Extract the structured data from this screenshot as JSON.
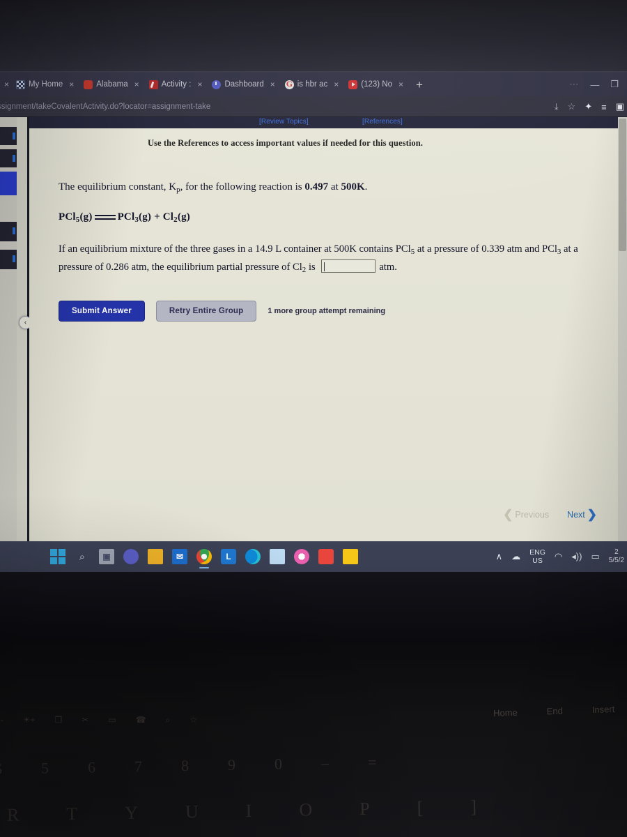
{
  "browser": {
    "tabs": [
      {
        "label": "My Home",
        "favicon": "mosaic-icon",
        "close": "×"
      },
      {
        "label": "Alabama",
        "favicon": "red-square-icon",
        "close": "×"
      },
      {
        "label": "Activity :",
        "favicon": "pencil-icon",
        "close": "×"
      },
      {
        "label": "Dashboard",
        "favicon": "power-icon",
        "close": "×"
      },
      {
        "label": "is hbr ac",
        "favicon": "google-icon",
        "close": "×"
      },
      {
        "label": "(123) No",
        "favicon": "youtube-icon",
        "close": "×"
      }
    ],
    "leading_close": "×",
    "new_tab": "+",
    "window_controls": {
      "more": "⋯",
      "minimize": "—",
      "restore": "❐"
    },
    "url": "ssignment/takeCovalentActivity.do?locator=assignment-take",
    "omnibox_icons": {
      "install": "⤓",
      "star": "☆",
      "extensions": "✦",
      "reading_list": "≡",
      "profile": "▣"
    }
  },
  "page": {
    "top_links": {
      "review_topics": "[Review Topics]",
      "references": "[References]"
    },
    "reference_note": "Use the References to access important values if needed for this question.",
    "question": {
      "line1_pre": "The equilibrium constant, K",
      "line1_sub": "p",
      "line1_mid": ", for the following reaction is ",
      "kp_value": "0.497",
      "line1_at": " at ",
      "temperature": "500K",
      "line1_end": ".",
      "equation": {
        "reactant": "PCl5(g)",
        "arrow": "equilibrium-double-arrow",
        "products": "PCl3(g) + Cl2(g)"
      },
      "body_1": "If an equilibrium mixture of the three gases in a ",
      "volume": "14.9",
      "body_2": " L container at ",
      "temp2": "500K",
      "body_3": " contains ",
      "species_1": "PCl5",
      "body_4": " at a pressure of ",
      "pressure_1": "0.339",
      "body_5": " atm and ",
      "species_2": "PCl3",
      "body_6": " at a pressure of ",
      "pressure_2": "0.286",
      "body_7": " atm, the equilibrium partial pressure of ",
      "species_3": "Cl2",
      "body_8": " is ",
      "unit": "atm."
    },
    "answer_input": {
      "value": "",
      "placeholder": ""
    },
    "buttons": {
      "submit": "Submit Answer",
      "retry": "Retry Entire Group",
      "attempts": "1 more group attempt remaining"
    },
    "pager": {
      "previous": "Previous",
      "next": "Next",
      "prev_chevron": "❮",
      "next_chevron": "❯"
    },
    "sidebar_collapse": "‹"
  },
  "taskbar": {
    "icons": [
      {
        "name": "start-icon",
        "label": ""
      },
      {
        "name": "search-icon",
        "label": "⌕"
      },
      {
        "name": "task-view-icon",
        "label": "▣"
      },
      {
        "name": "teams-icon",
        "label": ""
      },
      {
        "name": "file-explorer-icon",
        "label": ""
      },
      {
        "name": "mail-icon",
        "label": "✉"
      },
      {
        "name": "chrome-icon",
        "label": ""
      },
      {
        "name": "lockdown-browser-icon",
        "label": "L"
      },
      {
        "name": "edge-icon",
        "label": ""
      },
      {
        "name": "photos-icon",
        "label": ""
      },
      {
        "name": "itunes-icon",
        "label": "♪"
      },
      {
        "name": "office-icon",
        "label": ""
      },
      {
        "name": "sticky-notes-icon",
        "label": ""
      }
    ],
    "tray": {
      "overflow": "∧",
      "cloud": "☁",
      "language_top": "ENG",
      "language_bottom": "US",
      "wifi": "◠",
      "volume": "◂))",
      "battery": "▭",
      "clock_top": "2",
      "clock_bottom": "5/5/2"
    }
  },
  "keyboard": {
    "fn_row": [
      "☀-",
      "☀+",
      "❐",
      "✂",
      "▭",
      "☎",
      "⌕",
      "☆"
    ],
    "number_row": [
      {
        "shift": "$",
        "key": ""
      },
      {
        "shift": "%",
        "key": "5"
      },
      {
        "shift": "^",
        "key": "6"
      },
      {
        "shift": "&",
        "key": "7"
      },
      {
        "shift": "*",
        "key": "8"
      },
      {
        "shift": "(",
        "key": "9"
      },
      {
        "shift": ")",
        "key": "0"
      },
      {
        "shift": "—",
        "key": "–"
      },
      {
        "shift": "+",
        "key": "="
      }
    ],
    "letter_row": [
      "R",
      "T",
      "Y",
      "U",
      "I",
      "O",
      "P",
      "[",
      "]"
    ],
    "nav_keys": [
      "Home",
      "End",
      "Insert"
    ]
  },
  "colors": {
    "browser_chrome": "#35354a",
    "page_background": "#e3e2d4",
    "link_blue": "#3b6fe0",
    "primary_button": "#2434a8",
    "secondary_button": "#b4b6c4",
    "taskbar": "#3d4257"
  }
}
